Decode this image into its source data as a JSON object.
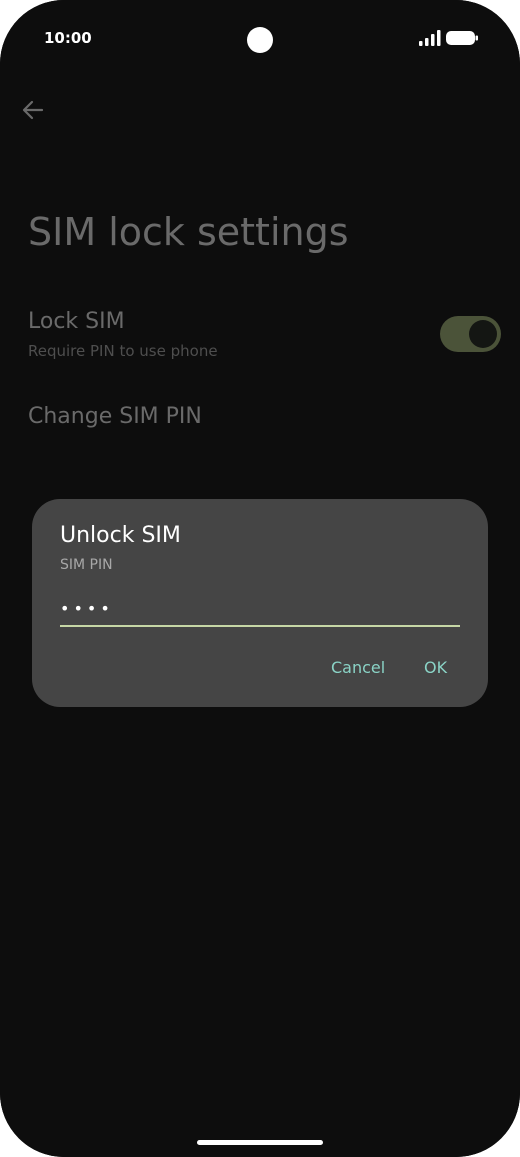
{
  "status_bar": {
    "time": "10:00"
  },
  "icons": {
    "back": "arrow-back-icon",
    "signal": "signal-icon",
    "battery": "battery-icon"
  },
  "page": {
    "title": "SIM lock settings"
  },
  "settings": {
    "lock_sim": {
      "title": "Lock SIM",
      "subtitle": "Require PIN to use phone",
      "enabled": true
    },
    "change_pin": {
      "title": "Change SIM PIN"
    }
  },
  "dialog": {
    "title": "Unlock SIM",
    "field_label": "SIM PIN",
    "pin_value": "••••",
    "cancel_label": "Cancel",
    "ok_label": "OK"
  },
  "colors": {
    "accent_button": "#8ad3c6",
    "input_underline": "#c6d7a6",
    "toggle_track": "#4b5339"
  }
}
